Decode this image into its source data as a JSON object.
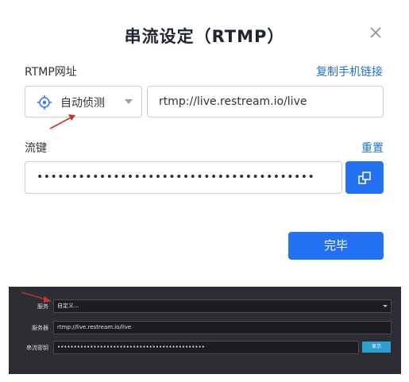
{
  "dialog": {
    "title": "串流设定（RTMP）",
    "rtmp_label": "RTMP网址",
    "copy_mobile_link": "复制手机链接",
    "server_select": "自动侦测",
    "server_url": "rtmp://live.restream.io/live",
    "stream_key_label": "流键",
    "reset_link": "重置",
    "stream_key_value": "••••••••••••••••••••••••••••••••••••••••",
    "done_button": "完毕"
  },
  "obs_panel": {
    "service_label": "服务",
    "service_value": "自定义...",
    "server_label": "服务器",
    "server_value": "rtmp://live.restream.io/live",
    "stream_key_label": "串流密钥",
    "stream_key_value": "•••••••••••••••••••••••••••••••••••••••••••••",
    "show_button": "显示"
  },
  "colors": {
    "accent": "#2470f2",
    "link": "#1e6fd9",
    "arrow": "#c0392b",
    "dark_bg": "#2c2e34",
    "show_button": "#2d9fd3"
  },
  "icons": {
    "close": "close-icon",
    "target": "crosshair-target-icon",
    "copy": "copy-icon",
    "caret": "chevron-down-icon",
    "annotation": "red-arrow-icon"
  }
}
